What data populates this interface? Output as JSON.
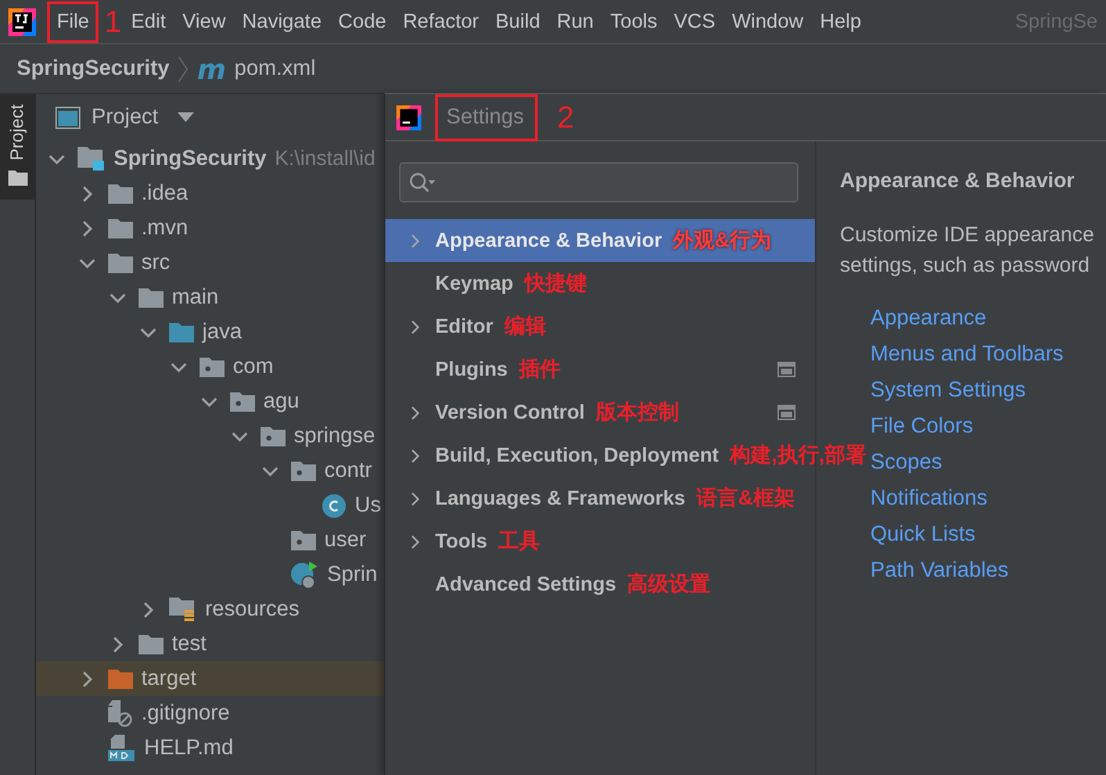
{
  "menu_bar": {
    "items": [
      {
        "label": "File",
        "highlighted": true
      },
      {
        "label": "Edit",
        "highlighted": false
      },
      {
        "label": "View",
        "highlighted": false
      },
      {
        "label": "Navigate",
        "highlighted": false
      },
      {
        "label": "Code",
        "highlighted": false
      },
      {
        "label": "Refactor",
        "highlighted": false
      },
      {
        "label": "Build",
        "highlighted": false
      },
      {
        "label": "Run",
        "highlighted": false
      },
      {
        "label": "Tools",
        "highlighted": false
      },
      {
        "label": "VCS",
        "highlighted": false
      },
      {
        "label": "Window",
        "highlighted": false
      },
      {
        "label": "Help",
        "highlighted": false
      }
    ],
    "step_mark": "1",
    "project_title": "SpringSe"
  },
  "breadcrumb": {
    "project": "SpringSecurity",
    "file_icon": "m",
    "file": "pom.xml"
  },
  "side_strip": {
    "tab": "Project"
  },
  "project_panel": {
    "title": "Project",
    "tree": [
      {
        "label": "SpringSecurity",
        "path": "K:\\install\\id",
        "kind": "module",
        "expanded": true,
        "selected": false,
        "children": [
          {
            "label": ".idea",
            "kind": "folder",
            "expanded": false,
            "selected": false
          },
          {
            "label": ".mvn",
            "kind": "folder",
            "expanded": false,
            "selected": false
          },
          {
            "label": "src",
            "kind": "folder",
            "expanded": true,
            "selected": false,
            "children": [
              {
                "label": "main",
                "kind": "folder",
                "expanded": true,
                "selected": false,
                "children": [
                  {
                    "label": "java",
                    "kind": "source",
                    "expanded": true,
                    "selected": false,
                    "children": [
                      {
                        "label": "com",
                        "kind": "package",
                        "expanded": true,
                        "selected": false,
                        "children": [
                          {
                            "label": "agu",
                            "kind": "package",
                            "expanded": true,
                            "selected": false,
                            "children": [
                              {
                                "label": "springse",
                                "kind": "package",
                                "expanded": true,
                                "selected": false,
                                "children": [
                                  {
                                    "label": "contr",
                                    "kind": "package",
                                    "expanded": true,
                                    "selected": false,
                                    "children": [
                                      {
                                        "label": "Us",
                                        "kind": "class",
                                        "selected": false
                                      }
                                    ]
                                  },
                                  {
                                    "label": "user",
                                    "kind": "package",
                                    "selected": false
                                  },
                                  {
                                    "label": "Sprin",
                                    "kind": "app",
                                    "selected": false
                                  }
                                ]
                              }
                            ]
                          }
                        ]
                      }
                    ]
                  },
                  {
                    "label": "resources",
                    "kind": "resources",
                    "expanded": false,
                    "selected": false
                  }
                ]
              },
              {
                "label": "test",
                "kind": "folder",
                "expanded": false,
                "selected": false
              }
            ]
          },
          {
            "label": "target",
            "kind": "excluded",
            "expanded": false,
            "selected": true
          },
          {
            "label": ".gitignore",
            "kind": "ignore",
            "selected": false
          },
          {
            "label": "HELP.md",
            "kind": "markdown",
            "selected": false
          }
        ]
      }
    ]
  },
  "settings": {
    "title": "Settings",
    "title_highlighted": true,
    "step_mark": "2",
    "nav": [
      {
        "label": "Appearance & Behavior",
        "note": "外观&行为",
        "expandable": true,
        "selected": true,
        "project_icon": false
      },
      {
        "label": "Keymap",
        "note": "快捷键",
        "expandable": false,
        "selected": false,
        "project_icon": false
      },
      {
        "label": "Editor",
        "note": "编辑",
        "expandable": true,
        "selected": false,
        "project_icon": false
      },
      {
        "label": "Plugins",
        "note": "插件",
        "expandable": false,
        "selected": false,
        "project_icon": true
      },
      {
        "label": "Version Control",
        "note": "版本控制",
        "expandable": true,
        "selected": false,
        "project_icon": true
      },
      {
        "label": "Build, Execution, Deployment",
        "note": "构建,执行,部署",
        "expandable": true,
        "selected": false,
        "project_icon": false
      },
      {
        "label": "Languages & Frameworks",
        "note": "语言&框架",
        "expandable": true,
        "selected": false,
        "project_icon": false
      },
      {
        "label": "Tools",
        "note": "工具",
        "expandable": true,
        "selected": false,
        "project_icon": false
      },
      {
        "label": "Advanced Settings",
        "note": "高级设置",
        "expandable": false,
        "selected": false,
        "project_icon": false
      }
    ],
    "content": {
      "heading": "Appearance & Behavior",
      "description_lines": [
        "Customize IDE appearance",
        "settings, such as password"
      ],
      "links": [
        "Appearance",
        "Menus and Toolbars",
        "System Settings",
        "File Colors",
        "Scopes",
        "Notifications",
        "Quick Lists",
        "Path Variables"
      ]
    }
  }
}
